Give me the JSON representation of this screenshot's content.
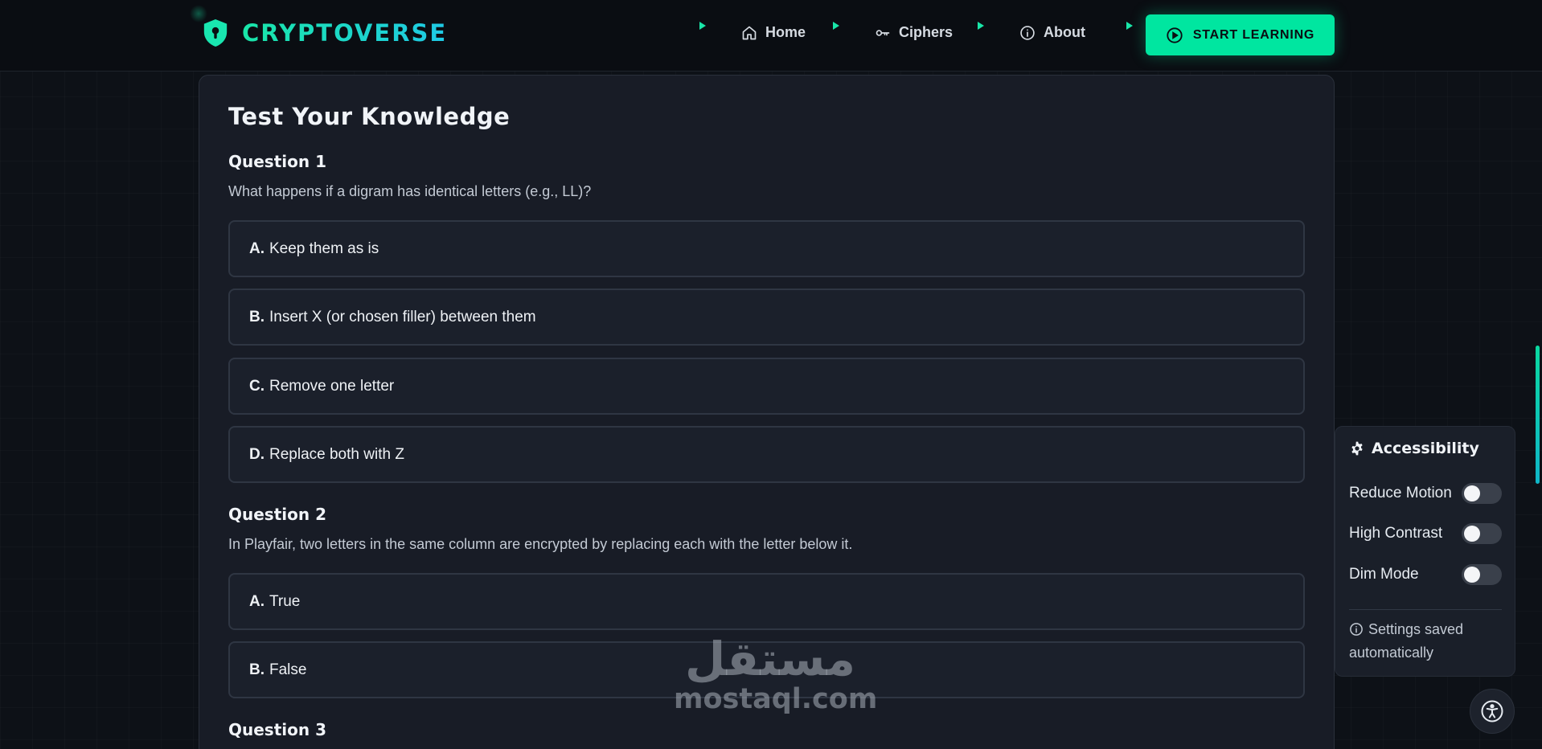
{
  "navbar": {
    "brand": "CRYPTOVERSE",
    "links": [
      {
        "label": "Home",
        "icon": "home-icon"
      },
      {
        "label": "Ciphers",
        "icon": "key-icon"
      },
      {
        "label": "About",
        "icon": "info-icon"
      }
    ],
    "cta_label": "START LEARNING",
    "accent": "#00e6a0"
  },
  "quiz": {
    "title": "Test Your Knowledge",
    "questions": [
      {
        "heading": "Question 1",
        "text": "What happens if a digram has identical letters (e.g., LL)?",
        "options": [
          {
            "letter": "A.",
            "text": "Keep them as is"
          },
          {
            "letter": "B.",
            "text": "Insert X (or chosen filler) between them"
          },
          {
            "letter": "C.",
            "text": "Remove one letter"
          },
          {
            "letter": "D.",
            "text": "Replace both with Z"
          }
        ]
      },
      {
        "heading": "Question 2",
        "text": "In Playfair, two letters in the same column are encrypted by replacing each with the letter below it.",
        "options": [
          {
            "letter": "A.",
            "text": "True"
          },
          {
            "letter": "B.",
            "text": "False"
          }
        ]
      },
      {
        "heading": "Question 3"
      }
    ]
  },
  "accessibility": {
    "title": "Accessibility",
    "settings": [
      {
        "label": "Reduce Motion",
        "enabled": false
      },
      {
        "label": "High Contrast",
        "enabled": false
      },
      {
        "label": "Dim Mode",
        "enabled": false
      }
    ],
    "note": "Settings saved automatically"
  },
  "watermark": {
    "arabic": "مستقل",
    "latin": "mostaql.com"
  }
}
